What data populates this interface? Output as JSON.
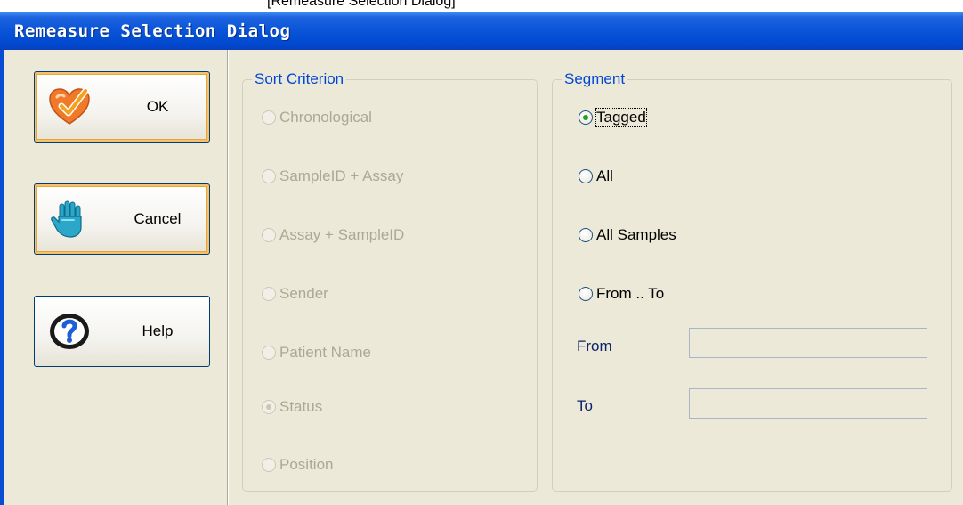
{
  "top_caption": "[Remeasure Selection Dialog]",
  "window": {
    "title": "Remeasure Selection Dialog"
  },
  "buttons": {
    "ok": {
      "label": "OK",
      "icon": "checkmark-heart-icon"
    },
    "cancel": {
      "label": "Cancel",
      "icon": "hand-stop-icon"
    },
    "help": {
      "label": "Help",
      "icon": "help-question-icon"
    }
  },
  "sort_criterion": {
    "legend": "Sort Criterion",
    "enabled": false,
    "selected": "Status",
    "options": [
      "Chronological",
      "SampleID + Assay",
      "Assay + SampleID",
      "Sender",
      "Patient Name",
      "Status",
      "Position"
    ]
  },
  "segment": {
    "legend": "Segment",
    "selected": "Tagged",
    "options": [
      "Tagged",
      "All",
      "All Samples",
      "From .. To"
    ],
    "from_label": "From",
    "to_label": "To",
    "from_value": "",
    "to_value": ""
  },
  "colors": {
    "title_bar": "#0a55d8",
    "dialog_bg": "#ece9d8",
    "group_label": "#0046d5",
    "field_label": "#0a246a",
    "disabled_text": "#aca899",
    "radio_selected": "#21a121",
    "focus_border": "#e7a53a"
  }
}
